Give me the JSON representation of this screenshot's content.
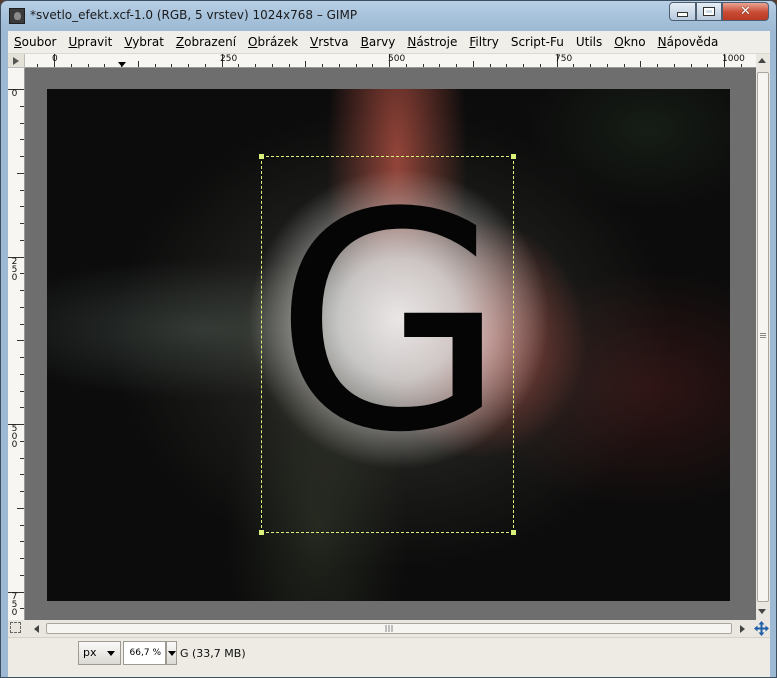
{
  "window": {
    "title": "*svetlo_efekt.xcf-1.0 (RGB, 5 vrstev) 1024x768 – GIMP"
  },
  "menu": [
    {
      "ul": "S",
      "rest": "oubor"
    },
    {
      "ul": "U",
      "rest": "pravit"
    },
    {
      "ul": "V",
      "rest": "ybrat"
    },
    {
      "ul": "Z",
      "rest": "obrazení"
    },
    {
      "ul": "O",
      "rest": "brázek"
    },
    {
      "ul": "V",
      "rest": "rstva"
    },
    {
      "ul": "B",
      "rest": "arvy"
    },
    {
      "ul": "N",
      "rest": "ástroje"
    },
    {
      "ul": "F",
      "rest": "iltry"
    },
    {
      "ul": "",
      "rest": "Script-Fu"
    },
    {
      "ul": "",
      "rest": "Utils"
    },
    {
      "ul": "O",
      "rest": "kno"
    },
    {
      "ul": "N",
      "rest": "ápověda"
    }
  ],
  "rulers": {
    "horizontal": [
      "0",
      "250",
      "500",
      "750",
      "1000"
    ],
    "vertical": [
      "0",
      "250",
      "500",
      "750"
    ]
  },
  "canvas": {
    "text_layer": "G"
  },
  "status": {
    "unit": "px",
    "zoom": "66,7 %",
    "info": "G (33,7 MB)"
  }
}
